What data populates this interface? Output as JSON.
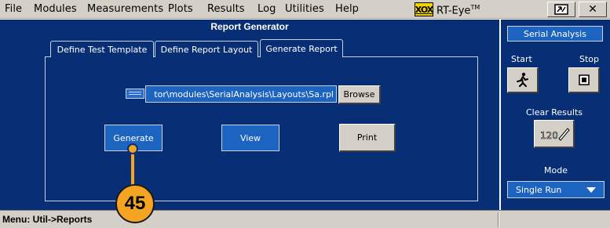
{
  "menu": {
    "items": [
      "File",
      "Modules",
      "Measurements",
      "Plots",
      "Results",
      "Log",
      "Utilities",
      "Help"
    ],
    "logo": "XOX",
    "product": "RT-Eye",
    "trademark": "TM"
  },
  "main": {
    "title": "Report Generator",
    "tabs": [
      "Define Test Template",
      "Define Report Layout",
      "Generate Report"
    ],
    "active_tab": "Generate Report",
    "path_value": "tor\\modules\\SerialAnalysis\\Layouts\\Sa.rpl",
    "browse_label": "Browse",
    "generate_label": "Generate",
    "view_label": "View",
    "print_label": "Print"
  },
  "side": {
    "title": "Serial Analysis",
    "start_label": "Start",
    "stop_label": "Stop",
    "clear_label": "Clear Results",
    "mode_label": "Mode",
    "mode_value": "Single Run"
  },
  "status": {
    "text": "Menu: Util->Reports"
  },
  "callout": {
    "number": "45"
  },
  "icons": [
    "folder-icon",
    "run-icon",
    "stop-icon",
    "clear-results-icon",
    "dropdown-caret-icon",
    "window-toggle-icon",
    "close-icon"
  ],
  "colors": {
    "panel_bg": "#082f75",
    "field_blue": "#1d64c0",
    "chrome_gray": "#d4d0c8",
    "callout_orange": "#f4a422",
    "logo_yellow": "#f4d400"
  }
}
